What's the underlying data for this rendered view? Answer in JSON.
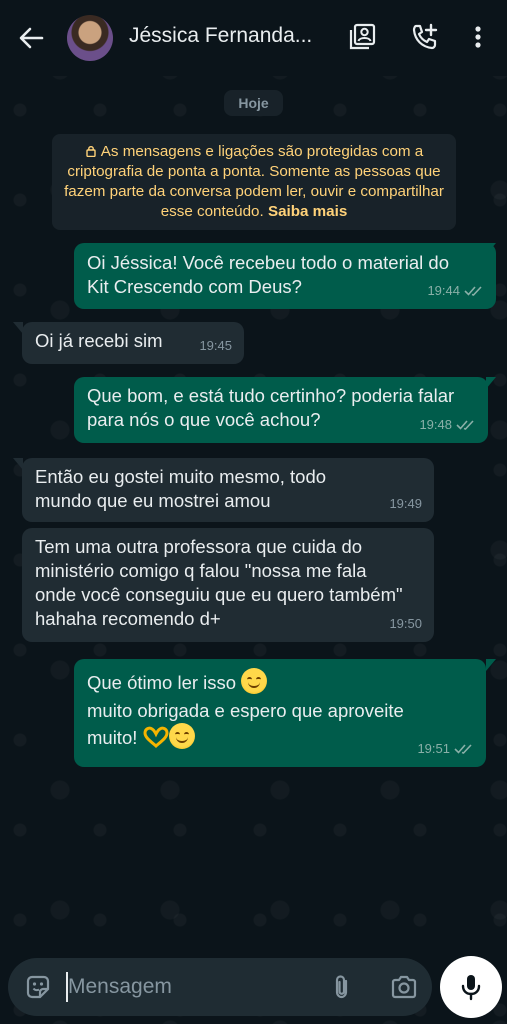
{
  "header": {
    "contact_name": "Jéssica Fernanda..."
  },
  "date_chip": "Hoje",
  "encryption_notice": {
    "text": "As mensagens e ligações são protegidas com a criptografia de ponta a ponta. Somente as pessoas que fazem parte da conversa podem ler, ouvir e compartilhar esse conteúdo.",
    "link": "Saiba mais"
  },
  "messages": [
    {
      "direction": "out",
      "text": "Oi Jéssica! Você recebeu todo o material do Kit Crescendo com Deus?",
      "time": "19:44",
      "status": "read"
    },
    {
      "direction": "in",
      "text": "Oi já recebi sim",
      "time": "19:45"
    },
    {
      "direction": "out",
      "text": "Que bom, e está tudo certinho? poderia falar para nós o que você achou?",
      "time": "19:48",
      "status": "read"
    },
    {
      "direction": "in",
      "text": "Então eu gostei muito mesmo, todo mundo que eu mostrei amou",
      "time": "19:49"
    },
    {
      "direction": "in",
      "text": "Tem uma outra professora que cuida do ministério comigo q falou \"nossa me fala onde você conseguiu que eu quero também\" hahaha recomendo d+",
      "time": "19:50"
    },
    {
      "direction": "out",
      "line1": "Que ótimo ler isso",
      "line2": "muito obrigada e espero que aproveite",
      "line3": "muito!",
      "time": "19:51",
      "status": "read"
    }
  ],
  "composer": {
    "placeholder": "Mensagem"
  },
  "colors": {
    "outgoing_bubble": "#005c4b",
    "incoming_bubble": "#202c33",
    "background": "#0b141a",
    "notice_text": "#ffd279"
  },
  "icons": {
    "back": "arrow-left-icon",
    "contact_card": "contact-card-icon",
    "add_call": "phone-plus-icon",
    "menu": "more-vertical-icon",
    "sticker": "sticker-icon",
    "attach": "paperclip-icon",
    "camera": "camera-icon",
    "mic": "microphone-icon"
  }
}
